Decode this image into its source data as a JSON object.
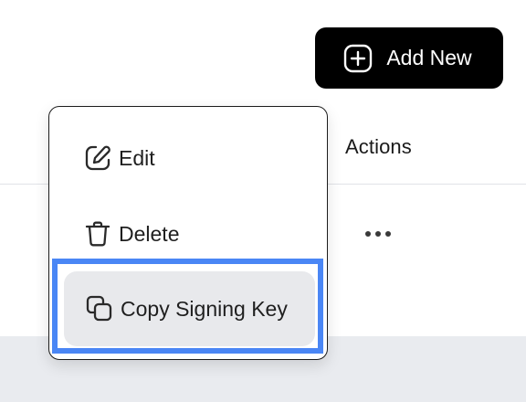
{
  "toolbar": {
    "add_new_label": "Add New",
    "add_new_icon": "plus-circle-icon"
  },
  "table": {
    "actions_header": "Actions",
    "row_actions_icon": "more-horizontal-icon"
  },
  "dropdown": {
    "items": [
      {
        "label": "Edit",
        "icon": "edit-icon"
      },
      {
        "label": "Delete",
        "icon": "trash-icon"
      },
      {
        "label": "Copy Signing Key",
        "icon": "copy-icon",
        "highlighted": true
      }
    ]
  },
  "colors": {
    "primary_button_bg": "#000000",
    "highlight_border": "#4a86f5",
    "hover_bg": "#e8e9ec"
  }
}
